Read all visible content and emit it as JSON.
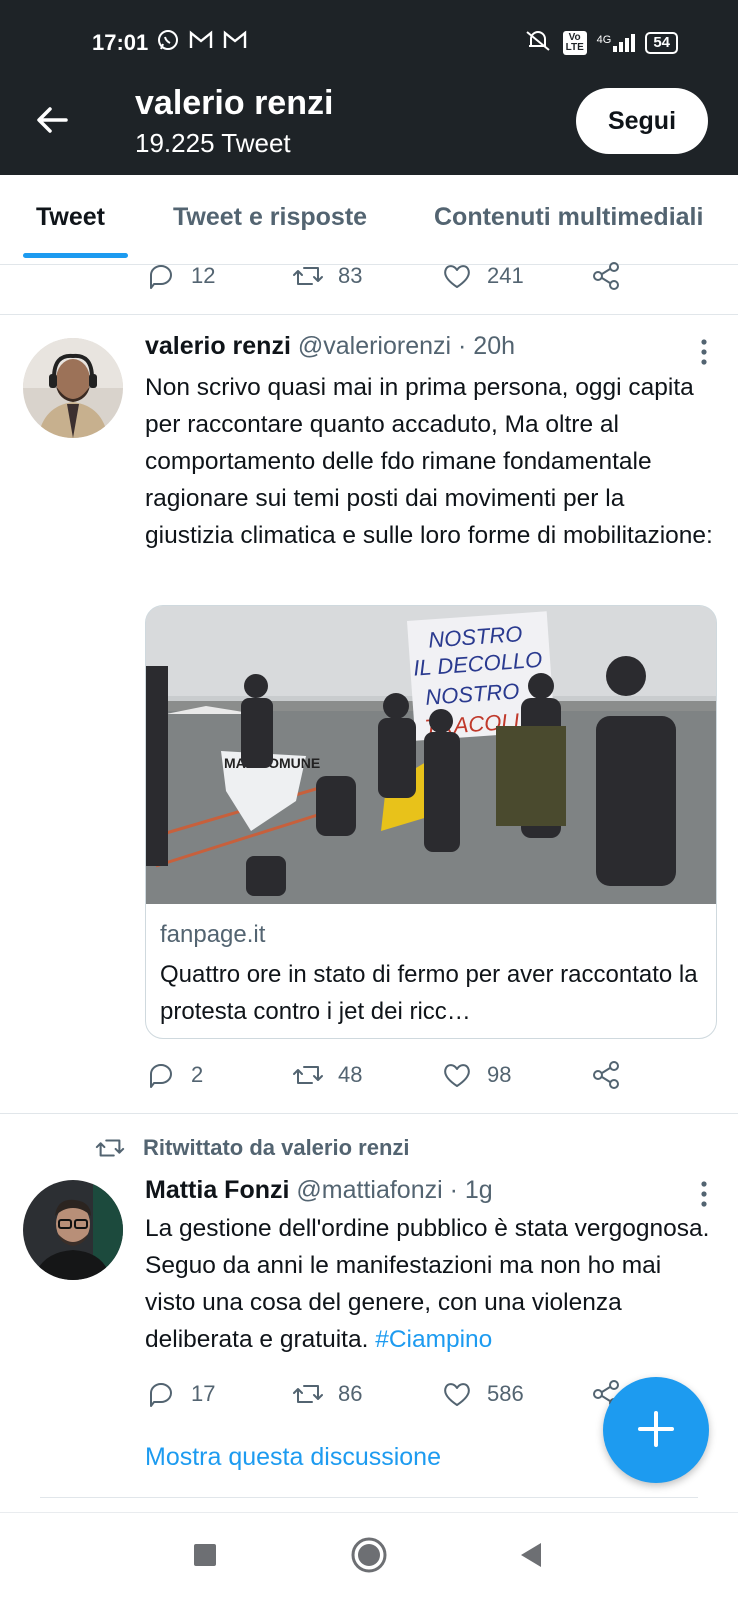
{
  "status_bar": {
    "time": "17:01",
    "notification_icons": [
      "whatsapp-icon",
      "gmail-icon",
      "gmail-icon"
    ],
    "right_icons": [
      "mute-icon",
      "volte-icon",
      "signal-4g-icon"
    ],
    "network": "4G",
    "volte": "Vo LTE",
    "battery": "54"
  },
  "header": {
    "title": "valerio renzi",
    "subtitle": "19.225 Tweet",
    "follow_label": "Segui"
  },
  "tabs": [
    {
      "label": "Tweet",
      "active": true
    },
    {
      "label": "Tweet e risposte",
      "active": false
    },
    {
      "label": "Contenuti multimediali",
      "active": false
    }
  ],
  "prev_tweet_actions": {
    "replies": "12",
    "retweets": "83",
    "likes": "241"
  },
  "tweet1": {
    "name": "valerio renzi",
    "handle": "@valeriorenzi",
    "time": "· 20h",
    "text": "Non scrivo quasi mai in prima persona, oggi capita per raccontare quanto accaduto, Ma oltre al comportamento delle fdo rimane fondamentale ragionare sui temi posti dai movimenti per la giustizia climatica e sulle loro forme di mobilitazione:",
    "card": {
      "domain": "fanpage.it",
      "title": "Quattro ore in stato di fermo per aver raccontato la protesta contro i jet dei ricc…",
      "image_text": [
        "NOSTRO",
        "IL DECOLLO",
        "NOSTRO",
        "TRACOLLO",
        "MAL COMUNE"
      ]
    },
    "actions": {
      "replies": "2",
      "retweets": "48",
      "likes": "98"
    }
  },
  "tweet2": {
    "retweeted_by": "Ritwittato da valerio renzi",
    "name": "Mattia Fonzi",
    "handle": "@mattiafonzi",
    "time": "· 1g",
    "text": "La gestione dell'ordine pubblico è stata vergognosa. Seguo da anni le manifestazioni ma non ho mai visto una cosa del genere, con una violenza deliberata e gratuita.",
    "hashtag": "#Ciampino",
    "actions": {
      "replies": "17",
      "retweets": "86",
      "likes": "586"
    },
    "show_thread": "Mostra questa discussione"
  },
  "colors": {
    "accent": "#1d9bf0",
    "header_bg": "#1e2327",
    "muted": "#536471"
  }
}
